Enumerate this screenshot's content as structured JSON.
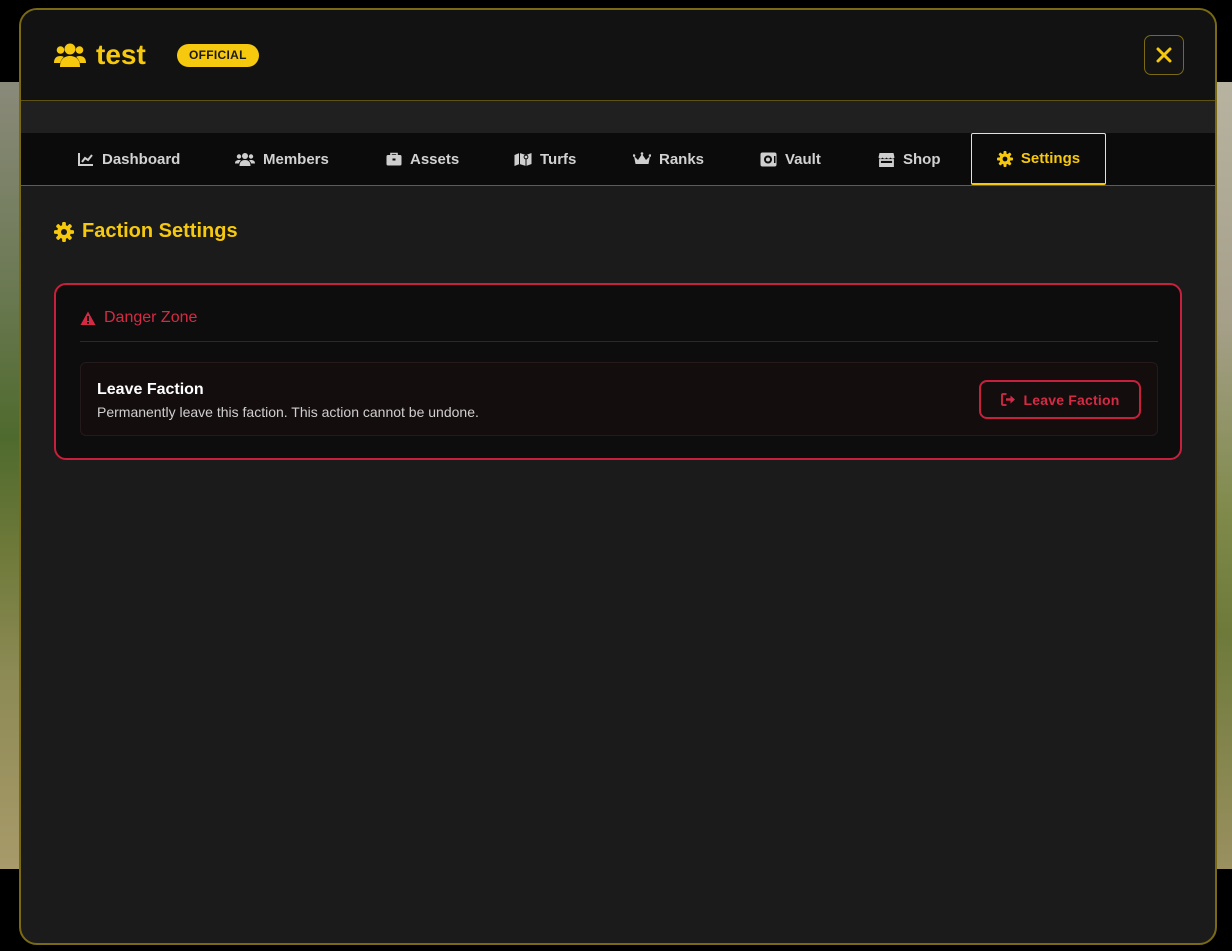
{
  "header": {
    "title": "test",
    "badge": "OFFICIAL",
    "icon": "users-icon",
    "close_icon": "close-icon"
  },
  "tabs": [
    {
      "label": "Dashboard",
      "icon": "chart-line-icon",
      "active": false
    },
    {
      "label": "Members",
      "icon": "users-icon",
      "active": false
    },
    {
      "label": "Assets",
      "icon": "briefcase-icon",
      "active": false
    },
    {
      "label": "Turfs",
      "icon": "map-icon",
      "active": false
    },
    {
      "label": "Ranks",
      "icon": "crown-icon",
      "active": false
    },
    {
      "label": "Vault",
      "icon": "vault-icon",
      "active": false
    },
    {
      "label": "Shop",
      "icon": "store-icon",
      "active": false
    },
    {
      "label": "Settings",
      "icon": "gear-icon",
      "active": true
    }
  ],
  "settings": {
    "section_title": "Faction Settings",
    "danger_zone": {
      "title": "Danger Zone",
      "leave": {
        "title": "Leave Faction",
        "description": "Permanently leave this faction. This action cannot be undone.",
        "button_label": "Leave Faction"
      }
    }
  },
  "colors": {
    "accent": "#f6c90e",
    "danger": "#c8203c",
    "background": "#1b1b1b"
  }
}
